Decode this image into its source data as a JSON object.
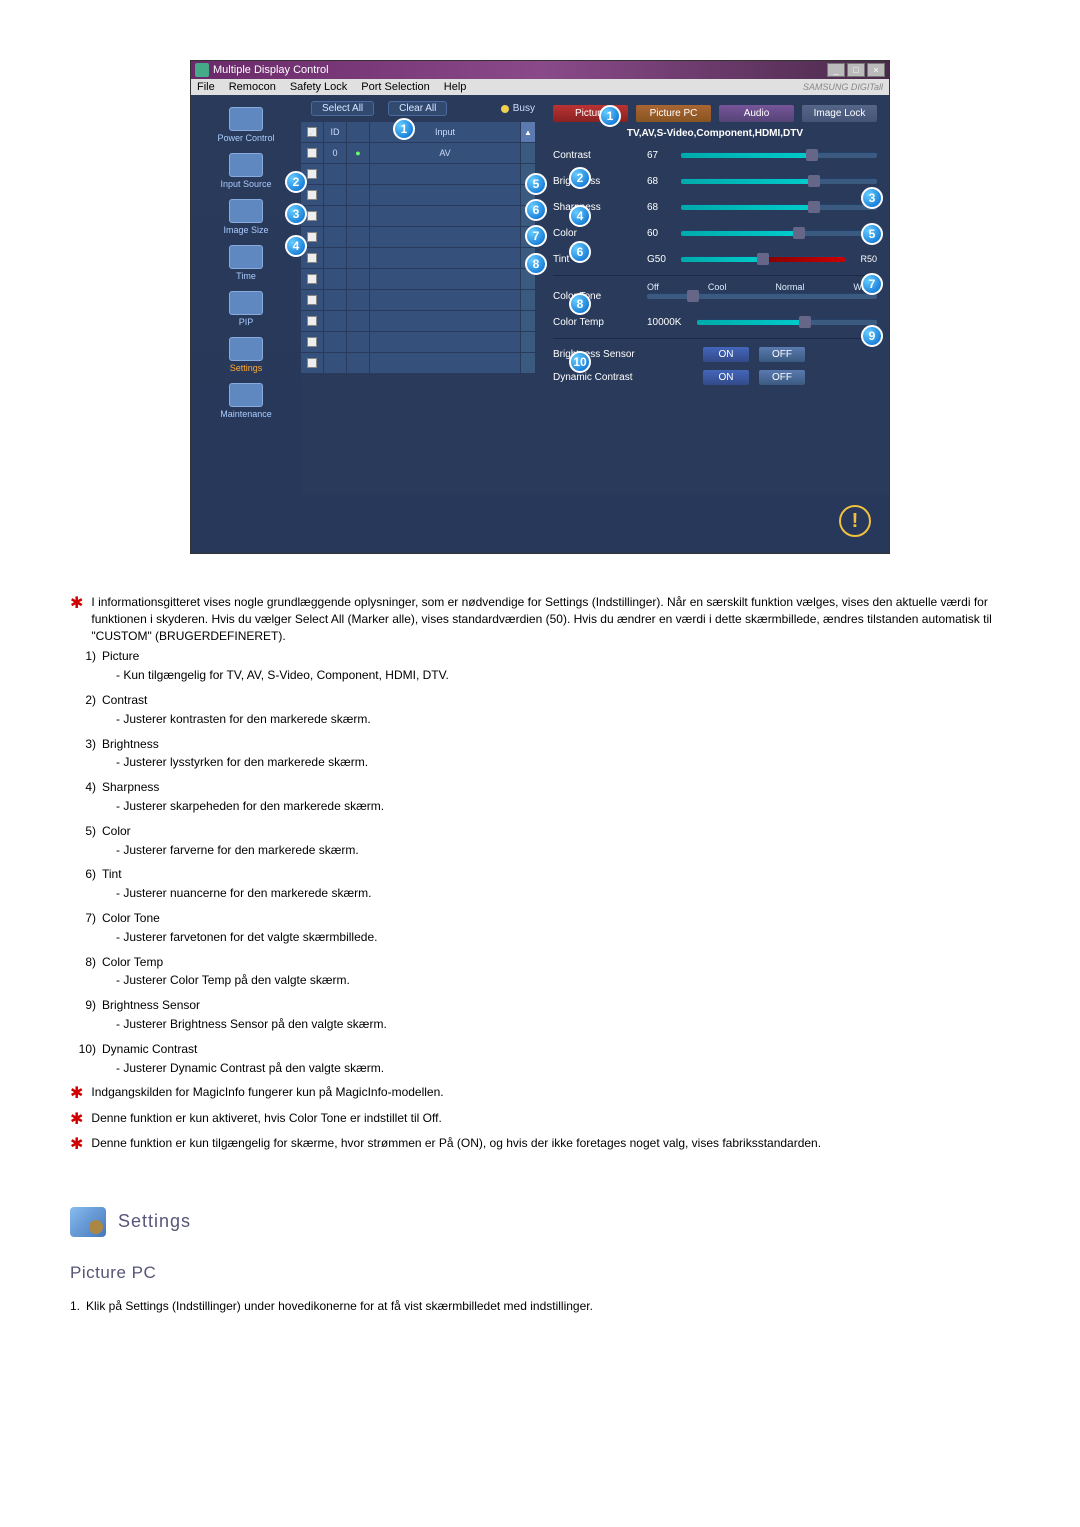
{
  "app": {
    "title": "Multiple Display Control",
    "menu": {
      "file": "File",
      "remocon": "Remocon",
      "safety": "Safety Lock",
      "port": "Port Selection",
      "help": "Help"
    },
    "brand": "SAMSUNG DIGITall",
    "sidebar": {
      "power": "Power Control",
      "input": "Input Source",
      "image": "Image Size",
      "time": "Time",
      "pip": "PIP",
      "settings": "Settings",
      "maintenance": "Maintenance"
    },
    "mid": {
      "select_all": "Select All",
      "clear_all": "Clear All",
      "busy": "Busy",
      "col_id": "ID",
      "col_input": "Input",
      "row_id": "0",
      "row_input": "AV"
    },
    "tabs": {
      "picture": "Picture",
      "picture_pc": "Picture PC",
      "audio": "Audio",
      "image_lock": "Image Lock"
    },
    "mode_line": "TV,AV,S-Video,Component,HDMI,DTV",
    "sliders": {
      "contrast": {
        "label": "Contrast",
        "value": "67"
      },
      "brightness": {
        "label": "Brightness",
        "value": "68"
      },
      "sharpness": {
        "label": "Sharpness",
        "value": "68"
      },
      "color": {
        "label": "Color",
        "value": "60"
      },
      "tint": {
        "label": "Tint",
        "value": "G50",
        "end": "R50"
      },
      "color_tone": {
        "label": "Color Tone",
        "opt_off": "Off",
        "opt_cool": "Cool",
        "opt_normal": "Normal",
        "opt_warm": "Warm"
      },
      "color_temp": {
        "label": "Color Temp",
        "value": "10000K"
      }
    },
    "brightness_sensor": {
      "label": "Brightness Sensor",
      "on": "ON",
      "off": "OFF"
    },
    "dynamic_contrast": {
      "label": "Dynamic Contrast",
      "on": "ON",
      "off": "OFF"
    }
  },
  "callouts": {
    "c1": "1",
    "c2": "2",
    "c3": "3",
    "c4": "4",
    "c5": "5",
    "c6": "6",
    "c7": "7",
    "c8": "8",
    "c9": "9",
    "c10": "10",
    "r1": "1",
    "r2": "2",
    "r3": "3",
    "r4": "4",
    "r5": "5",
    "r6": "6",
    "r7": "7",
    "r8": "8",
    "r9": "9",
    "r10": "10"
  },
  "doc": {
    "note_top": "I informationsgitteret vises nogle grundlæggende oplysninger, som er nødvendige for Settings (Indstillinger). Når en særskilt funktion vælges, vises den aktuelle værdi for funktionen i skyderen. Hvis du vælger Select All (Marker alle), vises standardværdien (50). Hvis du ændrer en værdi i dette skærmbillede, ændres tilstanden automatisk til \"CUSTOM\" (BRUGERDEFINERET).",
    "items": {
      "n1": "1)",
      "t1": "Picture",
      "d1": "- Kun tilgængelig for TV, AV, S-Video, Component, HDMI, DTV.",
      "n2": "2)",
      "t2": "Contrast",
      "d2": "- Justerer kontrasten for den markerede skærm.",
      "n3": "3)",
      "t3": "Brightness",
      "d3": "- Justerer lysstyrken for den markerede skærm.",
      "n4": "4)",
      "t4": "Sharpness",
      "d4": "- Justerer skarpeheden for den markerede skærm.",
      "n5": "5)",
      "t5": "Color",
      "d5": "- Justerer farverne for den markerede skærm.",
      "n6": "6)",
      "t6": "Tint",
      "d6": "- Justerer nuancerne for den markerede skærm.",
      "n7": "7)",
      "t7": "Color Tone",
      "d7": "- Justerer farvetonen for det valgte skærmbillede.",
      "n8": "8)",
      "t8": "Color Temp",
      "d8": "- Justerer Color Temp på den valgte skærm.",
      "n9": "9)",
      "t9": "Brightness Sensor",
      "d9": "- Justerer Brightness Sensor på den valgte skærm.",
      "n10": "10)",
      "t10": "Dynamic Contrast",
      "d10": "- Justerer Dynamic Contrast på den valgte skærm."
    },
    "note1": "Indgangskilden for MagicInfo fungerer kun på MagicInfo-modellen.",
    "note2": "Denne funktion er kun aktiveret, hvis Color Tone er indstillet til Off.",
    "note3": "Denne funktion er kun tilgængelig for skærme, hvor strømmen er På (ON), og hvis der ikke foretages noget valg, vises fabriksstandarden.",
    "settings_heading": "Settings",
    "picture_pc_heading": "Picture PC",
    "picture_pc_step1_num": "1.",
    "picture_pc_step1": "Klik på Settings (Indstillinger) under hovedikonerne for at få vist skærmbilledet med indstillinger."
  }
}
